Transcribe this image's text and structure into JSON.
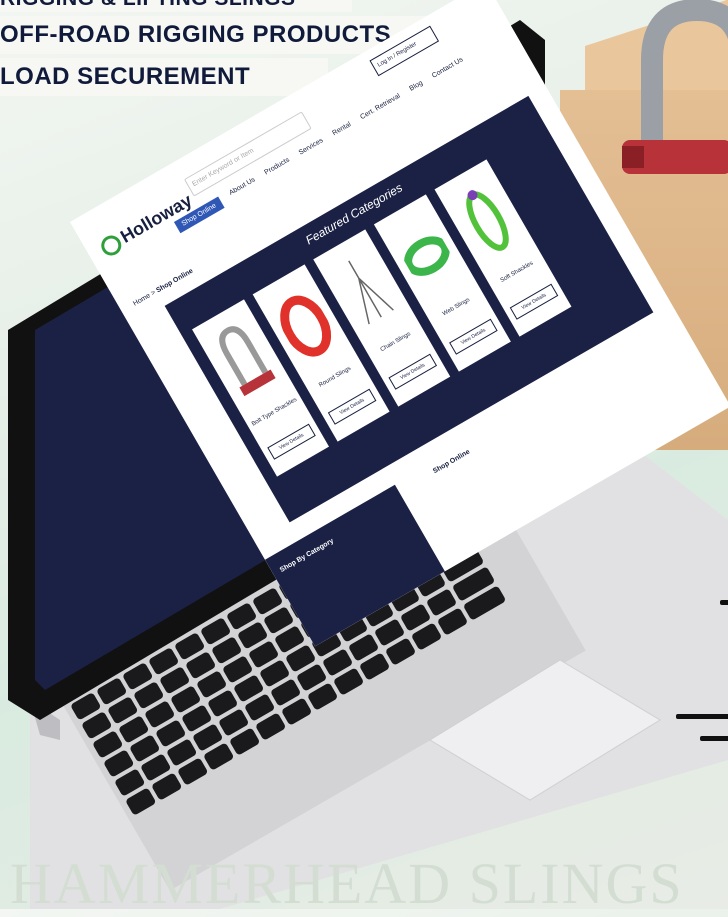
{
  "banners": [
    "RIGGING & LIFTING SLINGS",
    "OFF-ROAD RIGGING PRODUCTS",
    "LOAD SECUREMENT"
  ],
  "watermark": "HAMMERHEAD SLINGS",
  "site": {
    "logo": "Holloway",
    "search_placeholder": "Enter Keyword or Item",
    "login_label": "Log In / Register",
    "nav": [
      "Shop Online",
      "About Us",
      "Products",
      "Services",
      "Rental",
      "Cert. Retrieval",
      "Blog",
      "Contact Us"
    ],
    "breadcrumb": {
      "home": "Home",
      "current": "Shop Online"
    },
    "featured_title": "Featured Categories",
    "categories": [
      {
        "name": "Bolt Type Shackles",
        "cta": "View Details"
      },
      {
        "name": "Round Slings",
        "cta": "View Details"
      },
      {
        "name": "Chain Slings",
        "cta": "View Details"
      },
      {
        "name": "Web Slings",
        "cta": "View Details"
      },
      {
        "name": "Soft Shackles",
        "cta": "View Details"
      }
    ],
    "shop_online_heading": "Shop Online",
    "shop_by_category": "Shop By Category"
  },
  "colors": {
    "navy": "#1b2145",
    "accent_blue": "#2f57b5",
    "brand_green": "#2e9f3b"
  }
}
